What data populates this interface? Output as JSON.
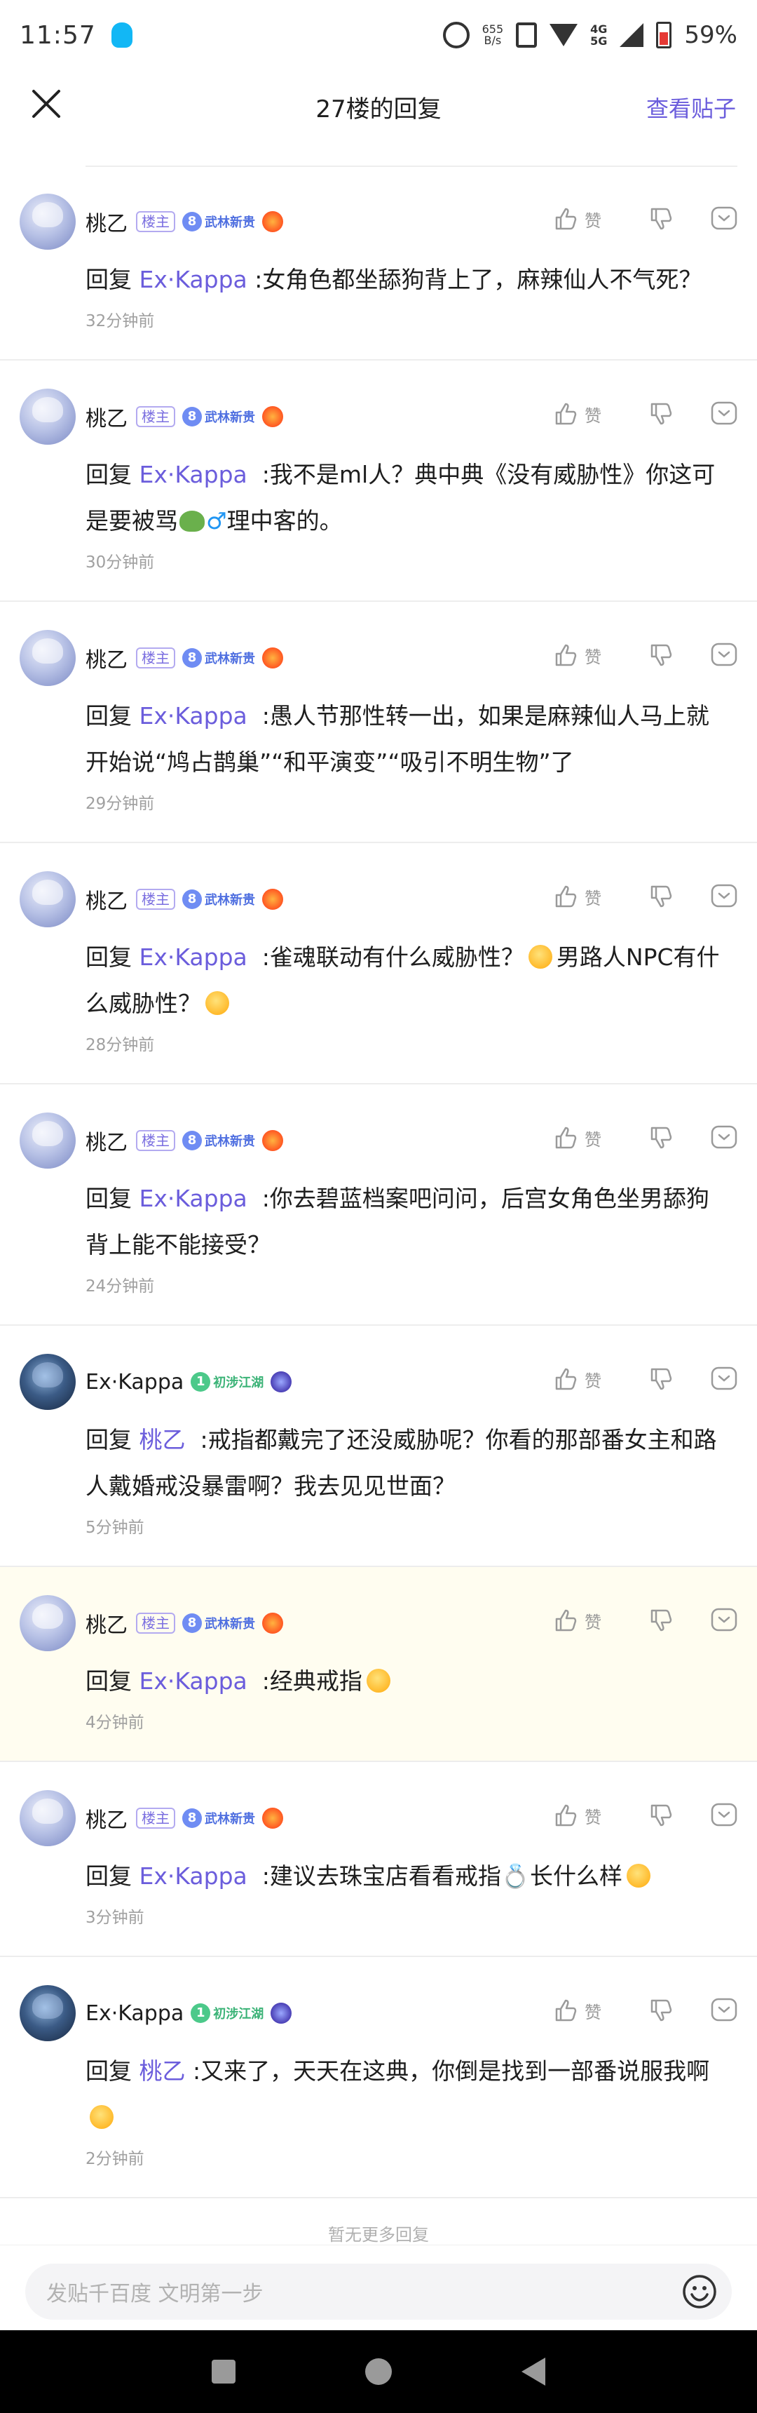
{
  "status_bar": {
    "time": "11:57",
    "net_speed": "655\nB/s",
    "net_type": "4G\n5G",
    "battery": "59%"
  },
  "nav": {
    "title": "27楼的回复",
    "view_post": "查看贴子"
  },
  "like_label": "赞",
  "comments": [
    {
      "user": "桃乙",
      "host_badge": "楼主",
      "level": "8",
      "level_name": "武林新贵",
      "reply_prefix": "回复",
      "reply_to": "Ex·Kappa",
      "sep": " :",
      "text": "女角色都坐舔狗背上了，麻辣仙人不气死？",
      "time": "32分钟前"
    },
    {
      "user": "桃乙",
      "host_badge": "楼主",
      "level": "8",
      "level_name": "武林新贵",
      "reply_prefix": "回复",
      "reply_to": "Ex·Kappa",
      "sep": "  :",
      "text_before": "我不是ml人？典中典《没有威胁性》你这可是要被骂",
      "text_after": "理中客的。",
      "time": "30分钟前"
    },
    {
      "user": "桃乙",
      "host_badge": "楼主",
      "level": "8",
      "level_name": "武林新贵",
      "reply_prefix": "回复",
      "reply_to": "Ex·Kappa",
      "sep": "  :",
      "text": "愚人节那性转一出，如果是麻辣仙人马上就开始说“鸠占鹊巢”“和平演变”“吸引不明生物”了",
      "time": "29分钟前"
    },
    {
      "user": "桃乙",
      "host_badge": "楼主",
      "level": "8",
      "level_name": "武林新贵",
      "reply_prefix": "回复",
      "reply_to": "Ex·Kappa",
      "sep": "  :",
      "text_before": "雀魂联动有什么威胁性？",
      "text_middle": "男路人NPC有什么威胁性？",
      "time": "28分钟前"
    },
    {
      "user": "桃乙",
      "host_badge": "楼主",
      "level": "8",
      "level_name": "武林新贵",
      "reply_prefix": "回复",
      "reply_to": "Ex·Kappa",
      "sep": "  :",
      "text": "你去碧蓝档案吧问问，后宫女角色坐男舔狗背上能不能接受？",
      "time": "24分钟前"
    },
    {
      "user": "Ex·Kappa",
      "level": "1",
      "level_name": "初涉江湖",
      "reply_prefix": "回复",
      "reply_to": "桃乙",
      "sep": "  :",
      "text": "戒指都戴完了还没威胁呢？你看的那部番女主和路人戴婚戒没暴雷啊？我去见见世面？",
      "time": "5分钟前"
    },
    {
      "user": "桃乙",
      "host_badge": "楼主",
      "level": "8",
      "level_name": "武林新贵",
      "reply_prefix": "回复",
      "reply_to": "Ex·Kappa",
      "sep": "  :",
      "text": "经典戒指",
      "time": "4分钟前"
    },
    {
      "user": "桃乙",
      "host_badge": "楼主",
      "level": "8",
      "level_name": "武林新贵",
      "reply_prefix": "回复",
      "reply_to": "Ex·Kappa",
      "sep": "  :",
      "text_before": "建议去珠宝店看看戒指",
      "text_after": "长什么样",
      "time": "3分钟前"
    },
    {
      "user": "Ex·Kappa",
      "level": "1",
      "level_name": "初涉江湖",
      "reply_prefix": "回复",
      "reply_to": "桃乙",
      "sep": " :",
      "text": "又来了，天天在这典，你倒是找到一部番说服我啊",
      "time": "2分钟前"
    }
  ],
  "no_more": "暂无更多回复",
  "input": {
    "placeholder": "发贴千百度 文明第一步"
  }
}
